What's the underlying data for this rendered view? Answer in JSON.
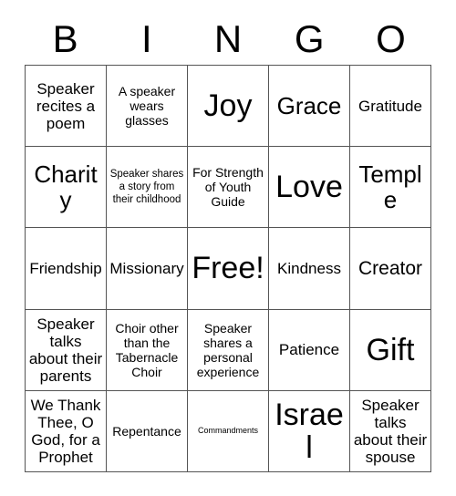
{
  "card": {
    "title_letters": [
      "B",
      "I",
      "N",
      "G",
      "O"
    ],
    "columns": 5,
    "rows": 5,
    "free_space_label": "Free!",
    "colors": {
      "background": "#ffffff",
      "text": "#000000",
      "grid_line": "#555555"
    },
    "cells": [
      [
        {
          "text": "Speaker recites a poem",
          "size": "md"
        },
        {
          "text": "A speaker wears glasses",
          "size": "sm"
        },
        {
          "text": "Joy",
          "size": "xxl"
        },
        {
          "text": "Grace",
          "size": "xl"
        },
        {
          "text": "Gratitude",
          "size": "md"
        }
      ],
      [
        {
          "text": "Charity",
          "size": "xl"
        },
        {
          "text": "Speaker shares a story from their childhood",
          "size": "xs"
        },
        {
          "text": "For Strength of Youth Guide",
          "size": "sm"
        },
        {
          "text": "Love",
          "size": "xxl"
        },
        {
          "text": "Temple",
          "size": "xl"
        }
      ],
      [
        {
          "text": "Friendship",
          "size": "md"
        },
        {
          "text": "Missionary",
          "size": "md"
        },
        {
          "text": "Free!",
          "size": "xxl"
        },
        {
          "text": "Kindness",
          "size": "md"
        },
        {
          "text": "Creator",
          "size": "lg"
        }
      ],
      [
        {
          "text": "Speaker talks about their parents",
          "size": "md"
        },
        {
          "text": "Choir other than the Tabernacle Choir",
          "size": "sm"
        },
        {
          "text": "Speaker shares a personal experience",
          "size": "sm"
        },
        {
          "text": "Patience",
          "size": "md"
        },
        {
          "text": "Gift",
          "size": "xxl"
        }
      ],
      [
        {
          "text": "We Thank Thee, O God, for a Prophet",
          "size": "md"
        },
        {
          "text": "Repentance",
          "size": "sm"
        },
        {
          "text": "Commandments",
          "size": "xxs"
        },
        {
          "text": "Israel",
          "size": "xxl"
        },
        {
          "text": "Speaker talks about their spouse",
          "size": "md"
        }
      ]
    ]
  }
}
